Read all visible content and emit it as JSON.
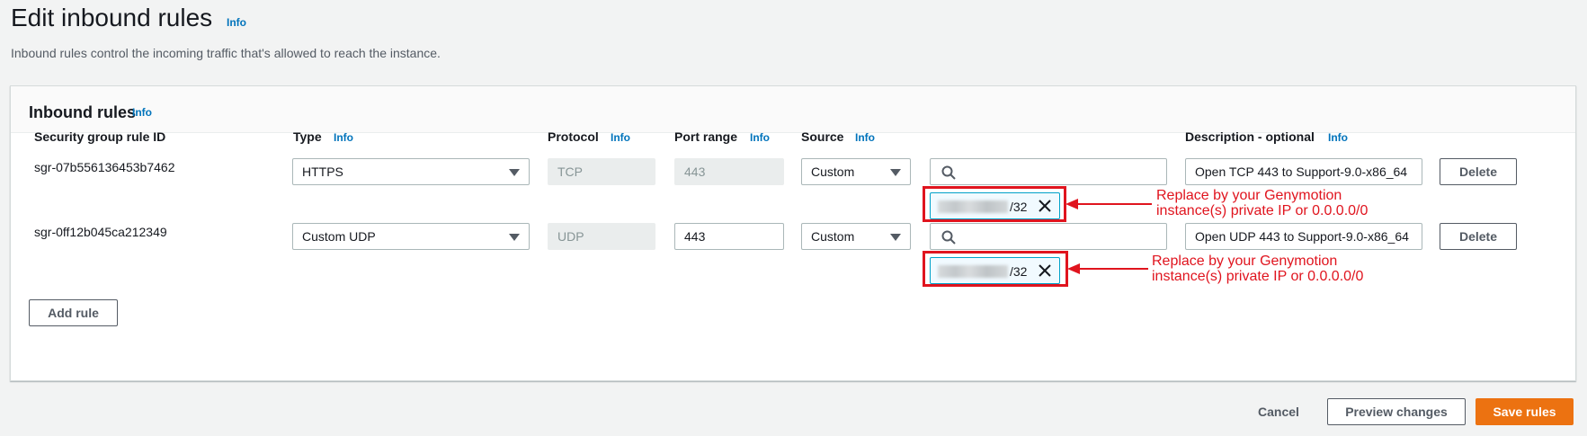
{
  "header": {
    "title": "Edit inbound rules",
    "info": "Info",
    "description": "Inbound rules control the incoming traffic that's allowed to reach the instance."
  },
  "panel": {
    "title": "Inbound rules",
    "info": "Info",
    "columns": {
      "rule_id": "Security group rule ID",
      "type": "Type",
      "type_info": "Info",
      "protocol": "Protocol",
      "protocol_info": "Info",
      "port_range": "Port range",
      "port_range_info": "Info",
      "source": "Source",
      "source_info": "Info",
      "description": "Description - optional",
      "description_info": "Info"
    },
    "rows": [
      {
        "rule_id": "sgr-07b556136453b7462",
        "type": "HTTPS",
        "protocol": "TCP",
        "port_range": "443",
        "source": "Custom",
        "search_value": "",
        "token_suffix": "/32",
        "description": "Open TCP 443 to Support-9.0-x86_64",
        "delete_label": "Delete",
        "annotation_line1": "Replace by your Genymotion",
        "annotation_line2": "instance(s) private IP or 0.0.0.0/0"
      },
      {
        "rule_id": "sgr-0ff12b045ca212349",
        "type": "Custom UDP",
        "protocol": "UDP",
        "port_range": "443",
        "source": "Custom",
        "search_value": "",
        "token_suffix": "/32",
        "description": "Open UDP 443 to Support-9.0-x86_64",
        "delete_label": "Delete",
        "annotation_line1": "Replace by your Genymotion",
        "annotation_line2": "instance(s) private IP or 0.0.0.0/0"
      }
    ],
    "add_rule_label": "Add rule"
  },
  "footer": {
    "cancel_label": "Cancel",
    "preview_label": "Preview changes",
    "save_label": "Save rules"
  },
  "colors": {
    "accent": "#ec7211",
    "link": "#0073bb",
    "annotation": "#e0141e",
    "token_border": "#00a1c9"
  }
}
